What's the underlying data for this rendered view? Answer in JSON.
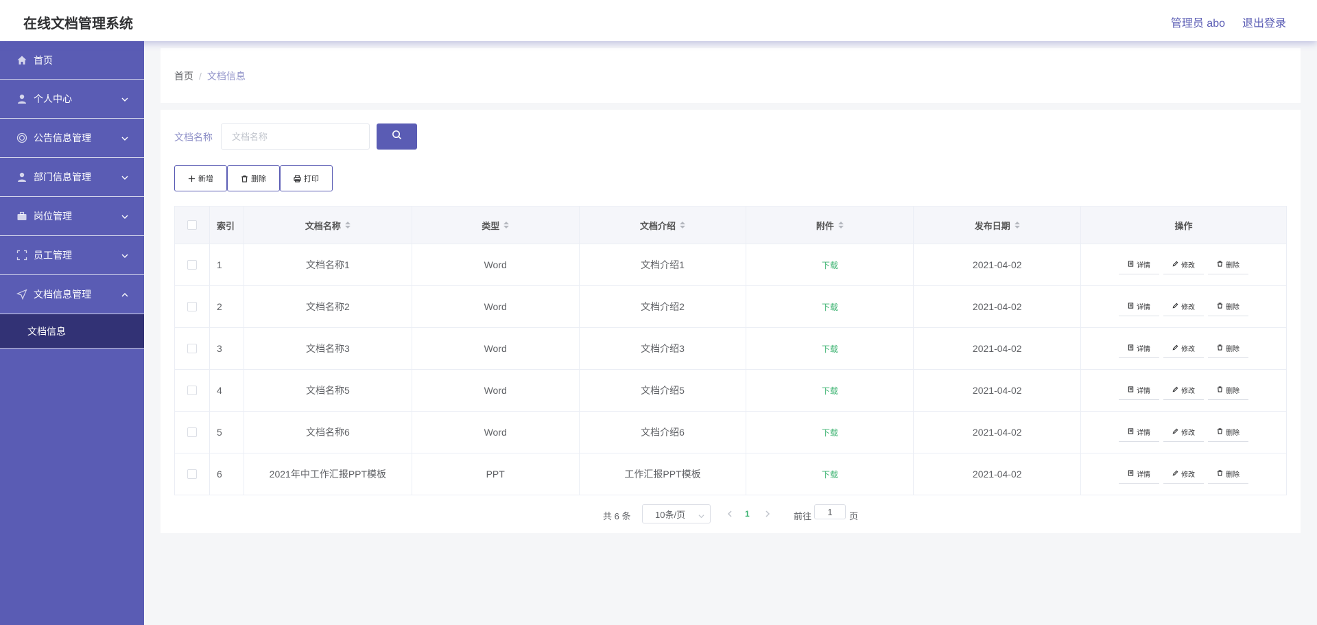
{
  "header": {
    "title": "在线文档管理系统",
    "admin": "管理员 abo",
    "logout": "退出登录"
  },
  "sidebar": {
    "items": [
      {
        "label": "首页",
        "icon": "home-icon"
      },
      {
        "label": "个人中心",
        "icon": "user-icon"
      },
      {
        "label": "公告信息管理",
        "icon": "notice-icon"
      },
      {
        "label": "部门信息管理",
        "icon": "user-icon"
      },
      {
        "label": "岗位管理",
        "icon": "briefcase-icon"
      },
      {
        "label": "员工管理",
        "icon": "frame-icon"
      },
      {
        "label": "文档信息管理",
        "icon": "send-icon"
      }
    ],
    "active_sub": "文档信息"
  },
  "breadcrumb": {
    "home": "首页",
    "separator": "/",
    "current": "文档信息"
  },
  "search": {
    "label": "文档名称",
    "placeholder": "文档名称",
    "value": ""
  },
  "actions": {
    "add": "新增",
    "delete": "删除",
    "print": "打印"
  },
  "table": {
    "headers": {
      "index": "索引",
      "name": "文档名称",
      "type": "类型",
      "intro": "文档介绍",
      "file": "附件",
      "date": "发布日期",
      "ops": "操作"
    },
    "rows": [
      {
        "index": "1",
        "name": "文档名称1",
        "type": "Word",
        "intro": "文档介绍1",
        "file": "下载",
        "date": "2021-04-02"
      },
      {
        "index": "2",
        "name": "文档名称2",
        "type": "Word",
        "intro": "文档介绍2",
        "file": "下载",
        "date": "2021-04-02"
      },
      {
        "index": "3",
        "name": "文档名称3",
        "type": "Word",
        "intro": "文档介绍3",
        "file": "下载",
        "date": "2021-04-02"
      },
      {
        "index": "4",
        "name": "文档名称5",
        "type": "Word",
        "intro": "文档介绍5",
        "file": "下载",
        "date": "2021-04-02"
      },
      {
        "index": "5",
        "name": "文档名称6",
        "type": "Word",
        "intro": "文档介绍6",
        "file": "下载",
        "date": "2021-04-02"
      },
      {
        "index": "6",
        "name": "2021年中工作汇报PPT模板",
        "type": "PPT",
        "intro": "工作汇报PPT模板",
        "file": "下载",
        "date": "2021-04-02"
      }
    ],
    "row_ops": {
      "detail": "详情",
      "edit": "修改",
      "delete": "删除"
    }
  },
  "pagination": {
    "total": "共 6 条",
    "page_size": "10条/页",
    "current": "1",
    "goto": "前往",
    "jump_value": "1",
    "page_unit": "页"
  },
  "colors": {
    "primary": "#5a5cb4",
    "sidebar_active": "#323275",
    "download": "#3cb371"
  }
}
